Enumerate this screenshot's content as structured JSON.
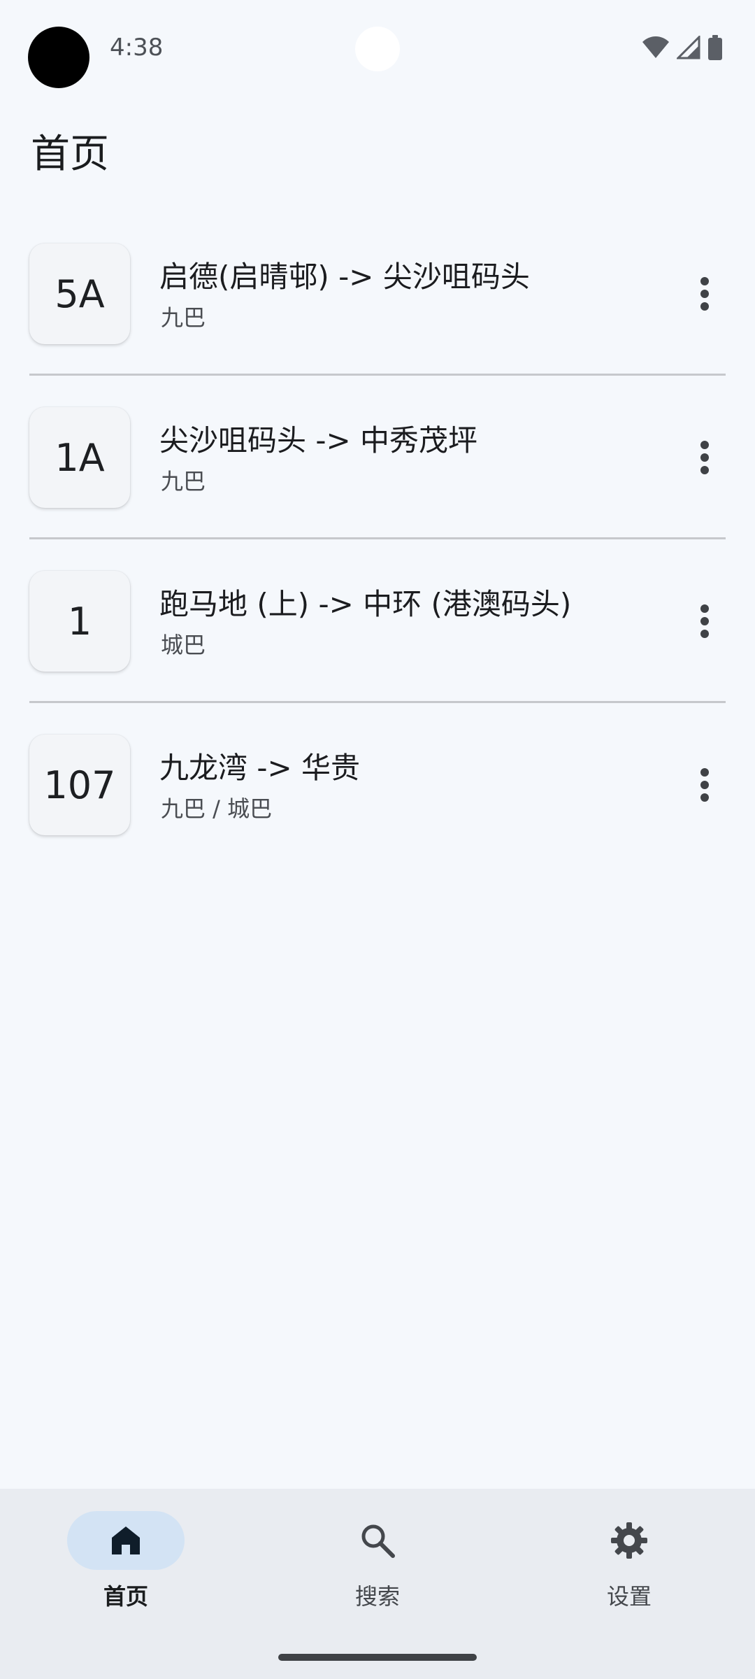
{
  "status_bar": {
    "time": "4:38",
    "icons": [
      "wifi-icon",
      "cell-signal-icon",
      "battery-icon"
    ]
  },
  "page": {
    "title": "首页"
  },
  "routes": [
    {
      "number": "5A",
      "title": "启德(启晴邨) -> 尖沙咀码头",
      "company": "九巴"
    },
    {
      "number": "1A",
      "title": "尖沙咀码头 -> 中秀茂坪",
      "company": "九巴"
    },
    {
      "number": "1",
      "title": "跑马地 (上) -> 中环 (港澳码头)",
      "company": "城巴"
    },
    {
      "number": "107",
      "title": "九龙湾 -> 华贵",
      "company": "九巴 / 城巴"
    }
  ],
  "bottom_nav": {
    "items": [
      {
        "label": "首页",
        "icon": "home-icon",
        "active": true
      },
      {
        "label": "搜索",
        "icon": "search-icon",
        "active": false
      },
      {
        "label": "设置",
        "icon": "gear-icon",
        "active": false
      }
    ]
  },
  "colors": {
    "background": "#f5f8fc",
    "nav_background": "#e9ecf1",
    "nav_active_pill": "#d3e3f4",
    "divider": "#c6c8cc"
  }
}
